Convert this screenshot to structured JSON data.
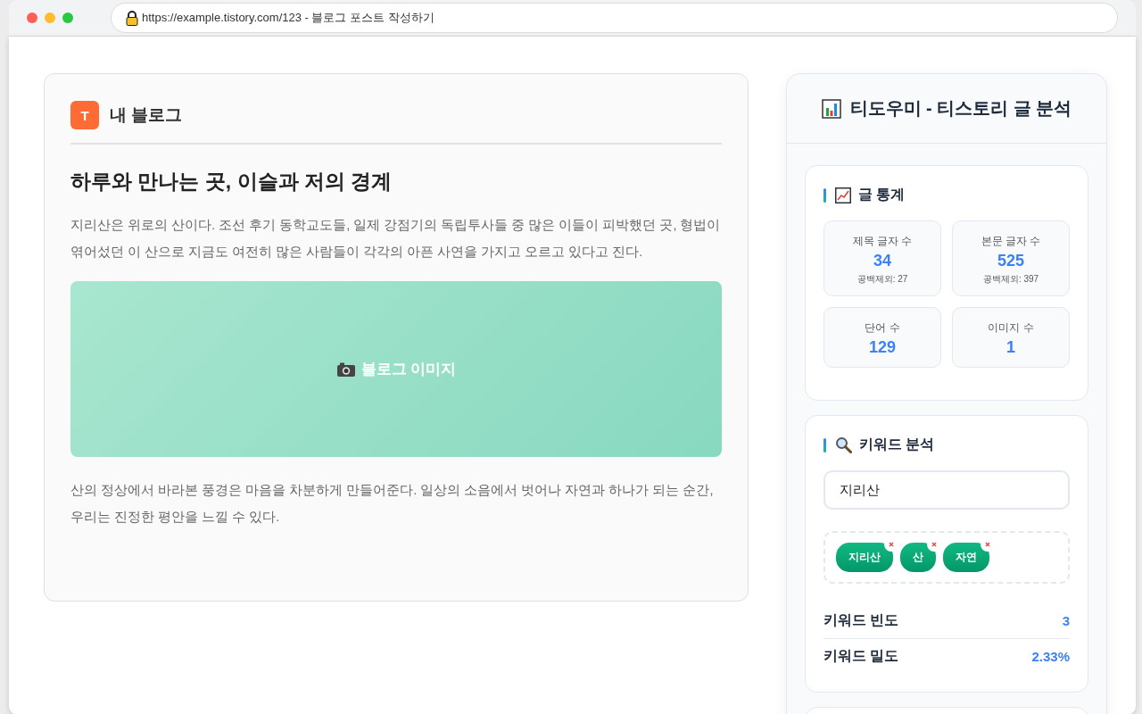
{
  "browser": {
    "url": "https://example.tistory.com/123 - 블로그 포스트 작성하기"
  },
  "post": {
    "blog_logo": "T",
    "blog_name": "내 블로그",
    "title": "하루와 만나는 곳, 이슬과 저의 경계",
    "blocks": [
      {
        "kind": "paragraph",
        "text": "지리산은 위로의 산이다. 조선 후기 동학교도들, 일제 강점기의 독립투사들 중 많은 이들이 피박했던 곳, 형법이 엮어섰던 이 산으로 지금도 여전히 많은 사람들이 각각의 아픈 사연을 가지고 오르고 있다고 진다."
      },
      {
        "kind": "image",
        "label": "블로그 이미지"
      },
      {
        "kind": "paragraph",
        "text": "산의 정상에서 바라본 풍경은 마음을 차분하게 만들어준다. 일상의 소음에서 벗어나 자연과 하나가 되는 순간, 우리는 진정한 평안을 느낄 수 있다."
      }
    ]
  },
  "panel": {
    "title": "티도우미 - 티스토리 글 분석",
    "stats": {
      "heading": "글 통계",
      "cards": [
        {
          "label": "제목 글자 수",
          "value": "34",
          "note": "공백제외: 27"
        },
        {
          "label": "본문 글자 수",
          "value": "525",
          "note": "공백제외: 397"
        },
        {
          "label": "단어 수",
          "value": "129"
        },
        {
          "label": "이미지 수",
          "value": "1"
        }
      ]
    },
    "keywords": {
      "heading": "키워드 분석",
      "input_value": "지리산",
      "tags": [
        "지리산",
        "산",
        "자연"
      ],
      "metrics": [
        {
          "label": "키워드 빈도",
          "value": "3"
        },
        {
          "label": "키워드 밀도",
          "value": "2.33%"
        }
      ]
    }
  }
}
